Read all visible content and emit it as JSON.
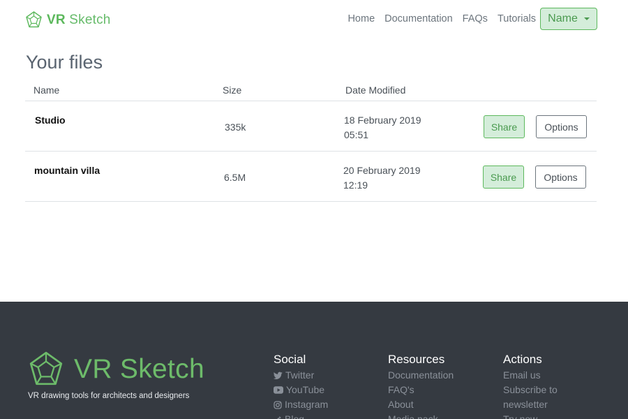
{
  "nav": {
    "brand": {
      "prefix": "VR",
      "suffix": "Sketch"
    },
    "links": [
      "Home",
      "Documentation",
      "FAQs",
      "Tutorials"
    ],
    "user_menu_label": "Name"
  },
  "main": {
    "title": "Your files",
    "columns": {
      "name": "Name",
      "size": "Size",
      "date": "Date Modified"
    },
    "files": [
      {
        "name": "Studio",
        "size": "335k",
        "date": "18 February 2019",
        "time": "05:51"
      },
      {
        "name": "mountain villa",
        "size": "6.5M",
        "date": "20 February 2019",
        "time": "12:19"
      }
    ],
    "share_label": "Share",
    "options_label": "Options"
  },
  "footer": {
    "brand": "VR Sketch",
    "tagline": "VR drawing tools for architects and designers",
    "social": {
      "title": "Social",
      "links": [
        "Twitter",
        "YouTube",
        "Instagram",
        "Blog"
      ]
    },
    "resources": {
      "title": "Resources",
      "links": [
        "Documentation",
        "FAQ's",
        "About",
        "Media pack"
      ]
    },
    "actions": {
      "title": "Actions",
      "links": [
        "Email us",
        "Subscribe to",
        "newsletter",
        "Try now"
      ]
    }
  },
  "colors": {
    "brand_green": "#5cb85c",
    "share_bg": "#d4edda",
    "footer_bg": "#353a41",
    "footer_link": "#8a9099"
  },
  "icons": {
    "brand": "dodecahedron-logo-icon",
    "twitter": "twitter-icon",
    "youtube": "youtube-icon",
    "instagram": "instagram-icon",
    "blog": "pencil-icon",
    "dropdown": "caret-down-icon"
  }
}
